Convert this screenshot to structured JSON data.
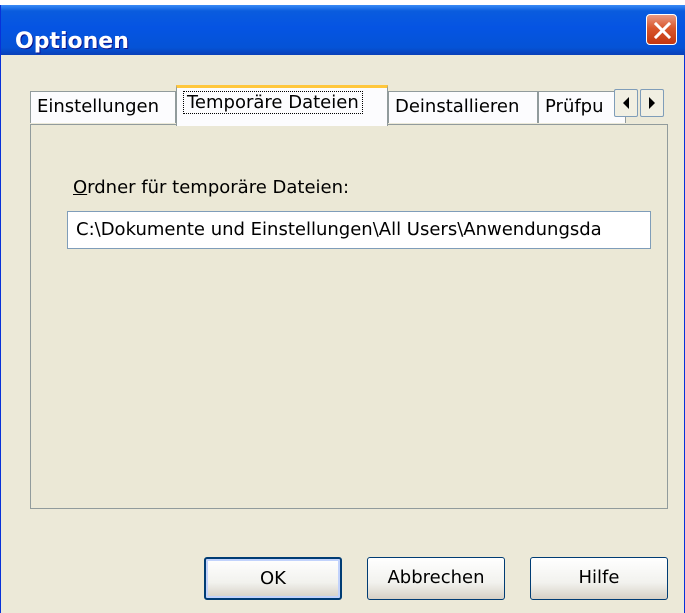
{
  "window": {
    "title": "Optionen"
  },
  "tabs": [
    {
      "label": "Einstellungen"
    },
    {
      "label": "Temporäre Dateien"
    },
    {
      "label": "Deinstallieren"
    },
    {
      "label": "Prüfpu"
    }
  ],
  "active_tab_index": 1,
  "panel": {
    "temp_folder_label_mnemonic": "O",
    "temp_folder_label_rest": "rdner für temporäre Dateien:",
    "temp_folder_value": "C:\\Dokumente und Einstellungen\\All Users\\Anwendungsda"
  },
  "buttons": {
    "ok": "OK",
    "cancel": "Abbrechen",
    "help": "Hilfe"
  },
  "colors": {
    "titlebar": "#0554e3",
    "dialog_bg": "#ece9d8",
    "tab_highlight": "#ffc73c",
    "close_button": "#d9572d"
  },
  "icons": {
    "close": "close-icon",
    "tab_scroll_left": "arrow-left-icon",
    "tab_scroll_right": "arrow-right-icon"
  }
}
